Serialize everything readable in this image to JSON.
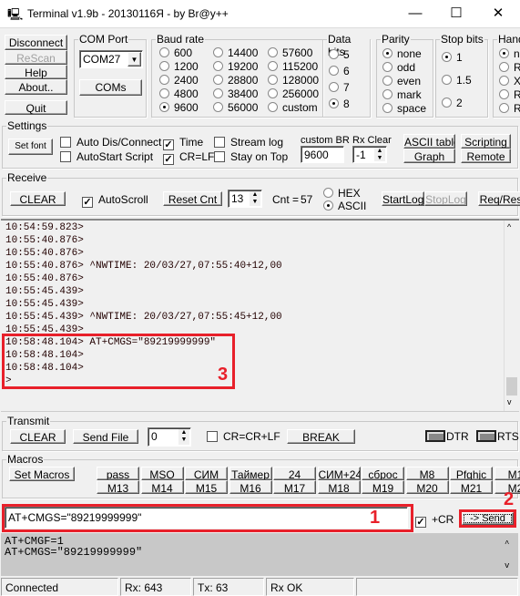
{
  "window": {
    "title": "Terminal v1.9b - 20130116Я - by Br@y++",
    "minimize": "—",
    "maximize": "☐",
    "close": "✕"
  },
  "left_buttons": {
    "disconnect": "Disconnect",
    "rescan": "ReScan",
    "help": "Help",
    "about": "About..",
    "quit": "Quit"
  },
  "com_port": {
    "label": "COM Port",
    "value": "COM27",
    "coms": "COMs"
  },
  "baud_rate": {
    "label": "Baud rate",
    "options": [
      "600",
      "1200",
      "2400",
      "4800",
      "9600",
      "14400",
      "19200",
      "28800",
      "38400",
      "56000",
      "57600",
      "115200",
      "128000",
      "256000",
      "custom"
    ],
    "selected": "9600"
  },
  "data_bits": {
    "label": "Data bits",
    "options": [
      "5",
      "6",
      "7",
      "8"
    ],
    "selected": "8"
  },
  "parity": {
    "label": "Parity",
    "options": [
      "none",
      "odd",
      "even",
      "mark",
      "space"
    ],
    "selected": "none"
  },
  "stop_bits": {
    "label": "Stop bits",
    "options": [
      "1",
      "1.5",
      "2"
    ],
    "selected": "1"
  },
  "handshaking": {
    "label": "Hand",
    "options": [
      "n",
      "R",
      "X",
      "R",
      "R"
    ],
    "selected": "n"
  },
  "settings": {
    "label": "Settings",
    "set_font": "Set font",
    "auto_dis_connect": "Auto Dis/Connect",
    "autostart_script": "AutoStart Script",
    "time": "Time",
    "cr_lf": "CR=LF",
    "stream_log": "Stream log",
    "stay_on_top": "Stay on Top",
    "custom_br_label": "custom BR",
    "custom_br": "9600",
    "rx_clear_label": "Rx Clear",
    "rx_clear": "-1",
    "ascii_table": "ASCII table",
    "graph": "Graph",
    "scripting": "Scripting",
    "remote": "Remote",
    "checked": {
      "auto_dis_connect": false,
      "autostart_script": false,
      "time": true,
      "cr_lf": true,
      "stream_log": false,
      "stay_on_top": false
    }
  },
  "receive": {
    "label": "Receive",
    "clear": "CLEAR",
    "autoscroll": "AutoScroll",
    "autoscroll_checked": true,
    "reset_cnt": "Reset Cnt",
    "cnt_spin": "13",
    "cnt_label": "Cnt =",
    "cnt": "57",
    "hex": "HEX",
    "ascii": "ASCII",
    "mode": "ASCII",
    "start_log": "StartLog",
    "stop_log": "StopLog",
    "req_resp": "Req/Res",
    "lines": [
      "10:54:59.823>",
      "10:55:40.876>",
      "10:55:40.876>",
      "10:55:40.876> ^NWTIME: 20/03/27,07:55:40+12,00",
      "10:55:40.876>",
      "10:55:45.439>",
      "10:55:45.439>",
      "10:55:45.439> ^NWTIME: 20/03/27,07:55:45+12,00",
      "10:55:45.439>",
      "10:58:48.104> AT+CMGS=\"89219999999\"",
      "10:58:48.104>",
      "10:58:48.104>",
      ">"
    ]
  },
  "transmit": {
    "label": "Transmit",
    "clear": "CLEAR",
    "send_file": "Send File",
    "spin": "0",
    "cr_crlf": "CR=CR+LF",
    "cr_crlf_checked": false,
    "break": "BREAK",
    "dtr": "DTR",
    "rts": "RTS"
  },
  "macros": {
    "label": "Macros",
    "set_macros": "Set Macros",
    "row1": [
      "pass",
      "MSO",
      "СИМ",
      "Таймер",
      "24",
      "СИМ+24",
      "сброс",
      "M8",
      "Pfghjc",
      "M1"
    ],
    "row2": [
      "M13",
      "M14",
      "M15",
      "M16",
      "M17",
      "M18",
      "M19",
      "M20",
      "M21",
      "M2"
    ]
  },
  "send": {
    "input": "AT+CMGS=\"89219999999\"",
    "plus_cr": "+CR",
    "plus_cr_checked": true,
    "send": "-> Send"
  },
  "tx_history": [
    "AT+CMGF=1",
    "AT+CMGS=\"89219999999\""
  ],
  "annotations": [
    "1",
    "2",
    "3"
  ],
  "annotation_color": "#e8202a",
  "status": {
    "connection": "Connected",
    "rx": "Rx: 643",
    "tx": "Tx: 63",
    "rx_status": "Rx OK"
  }
}
